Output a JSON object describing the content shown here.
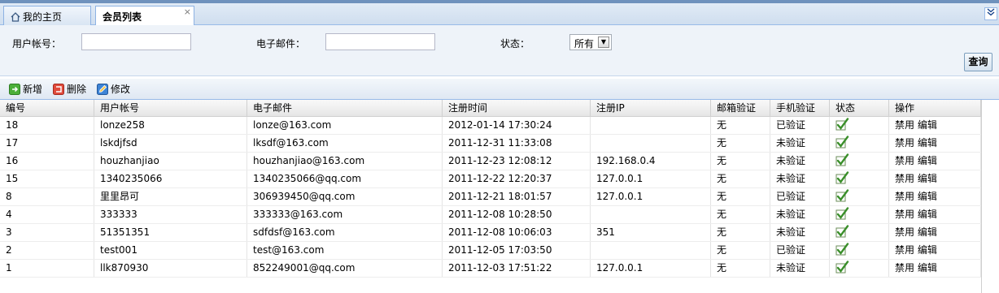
{
  "tabs": [
    {
      "label": "我的主页",
      "icon": "home-icon"
    },
    {
      "label": "会员列表",
      "close": "×"
    }
  ],
  "search": {
    "account_label": "用户帐号：",
    "account_value": "",
    "email_label": "电子邮件：",
    "email_value": "",
    "status_label": "状态：",
    "status_value": "所有",
    "query_label": "查询"
  },
  "toolbar": {
    "add_label": "新增",
    "delete_label": "删除",
    "edit_label": "修改"
  },
  "columns": [
    "编号",
    "用户帐号",
    "电子邮件",
    "注册时间",
    "注册IP",
    "邮箱验证",
    "手机验证",
    "状态",
    "操作"
  ],
  "rows": [
    {
      "id": "18",
      "account": "lonze258",
      "email": "lonze@163.com",
      "time": "2012-01-14 17:30:24",
      "ip": "",
      "email_verified": "无",
      "phone_verified": "已验证",
      "ops": "禁用 编辑"
    },
    {
      "id": "17",
      "account": "lskdjfsd",
      "email": "lksdf@163.com",
      "time": "2011-12-31 11:33:08",
      "ip": "",
      "email_verified": "无",
      "phone_verified": "未验证",
      "ops": "禁用 编辑"
    },
    {
      "id": "16",
      "account": "houzhanjiao",
      "email": "houzhanjiao@163.com",
      "time": "2011-12-23 12:08:12",
      "ip": "192.168.0.4",
      "email_verified": "无",
      "phone_verified": "未验证",
      "ops": "禁用 编辑"
    },
    {
      "id": "15",
      "account": "1340235066",
      "email": "1340235066@qq.com",
      "time": "2011-12-22 12:20:37",
      "ip": "127.0.0.1",
      "email_verified": "无",
      "phone_verified": "未验证",
      "ops": "禁用 编辑"
    },
    {
      "id": "8",
      "account": "里里昂可",
      "email": "306939450@qq.com",
      "time": "2011-12-21 18:01:57",
      "ip": "127.0.0.1",
      "email_verified": "无",
      "phone_verified": "已验证",
      "ops": "禁用 编辑"
    },
    {
      "id": "4",
      "account": "333333",
      "email": "333333@163.com",
      "time": "2011-12-08 10:28:50",
      "ip": "",
      "email_verified": "无",
      "phone_verified": "未验证",
      "ops": "禁用 编辑"
    },
    {
      "id": "3",
      "account": "51351351",
      "email": "sdfdsf@163.com",
      "time": "2011-12-08 10:06:03",
      "ip": "351",
      "email_verified": "无",
      "phone_verified": "未验证",
      "ops": "禁用 编辑"
    },
    {
      "id": "2",
      "account": "test001",
      "email": "test@163.com",
      "time": "2011-12-05 17:03:50",
      "ip": "",
      "email_verified": "无",
      "phone_verified": "已验证",
      "ops": "禁用 编辑"
    },
    {
      "id": "1",
      "account": "llk870930",
      "email": "852249001@qq.com",
      "time": "2011-12-03 17:51:22",
      "ip": "127.0.0.1",
      "email_verified": "无",
      "phone_verified": "未验证",
      "ops": "禁用 编辑"
    }
  ],
  "status_icon": "check-icon",
  "colors": {
    "accent": "#99bbe8",
    "check": "#3a8f2a"
  }
}
